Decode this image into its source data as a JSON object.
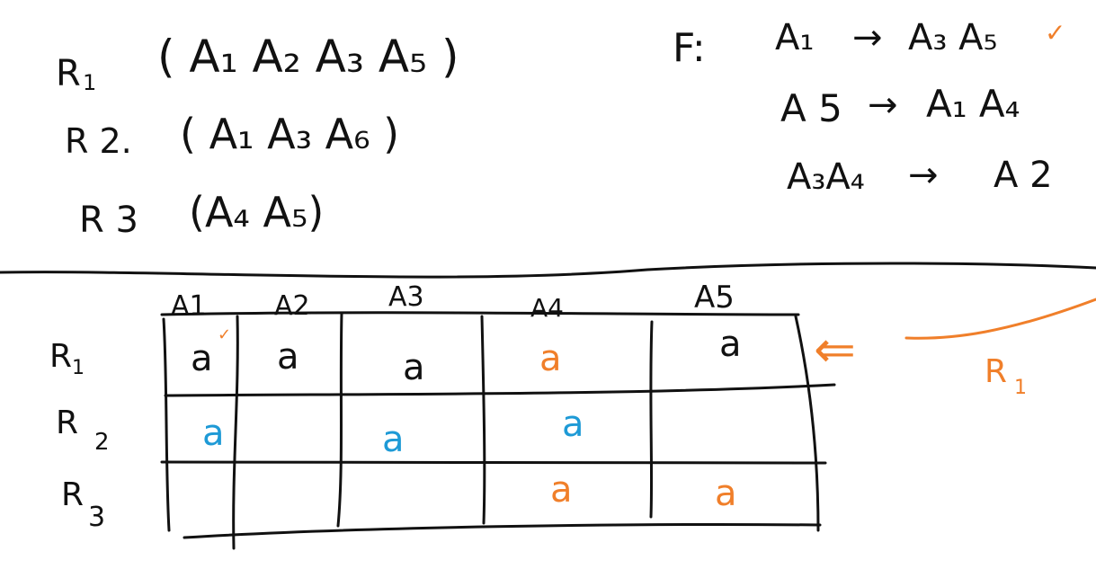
{
  "colors": {
    "ink": "#111111",
    "orange": "#f07f2a",
    "blue": "#1e9ad6",
    "background": "#ffffff"
  },
  "relations": [
    {
      "name": "R",
      "sub": "1",
      "attrs": "( A₁  A₂ A₃   A₅ )"
    },
    {
      "name": "R 2.",
      "sub": "",
      "attrs": "( A₁   A₃   A₆ )"
    },
    {
      "name": "R 3",
      "sub": "",
      "attrs": "(A₄ A₅)"
    }
  ],
  "fd_label": "F:",
  "fds": [
    {
      "lhs": "A₁",
      "arrow": "→",
      "rhs": "A₃ A₅",
      "mark": "✓"
    },
    {
      "lhs": "A 5",
      "arrow": "→",
      "rhs": "A₁ A₄",
      "mark": ""
    },
    {
      "lhs": "A₃A₄",
      "arrow": "→",
      "rhs": "A 2",
      "mark": ""
    }
  ],
  "table": {
    "columns": [
      "A1",
      "A2",
      "A3",
      "A4",
      "A5"
    ],
    "rows": [
      {
        "label": "R",
        "sub": "1",
        "cells": [
          {
            "v": "a",
            "color": "ink"
          },
          {
            "v": "a",
            "color": "ink"
          },
          {
            "v": "a",
            "color": "ink"
          },
          {
            "v": "a",
            "color": "orange"
          },
          {
            "v": "a",
            "color": "ink"
          }
        ]
      },
      {
        "label": "R",
        "sub": "2",
        "cells": [
          {
            "v": "a",
            "color": "blue"
          },
          {
            "v": "",
            "color": "ink"
          },
          {
            "v": "a",
            "color": "blue"
          },
          {
            "v": "a",
            "color": "blue"
          },
          {
            "v": "",
            "color": "ink"
          }
        ]
      },
      {
        "label": "R",
        "sub": "3",
        "cells": [
          {
            "v": "",
            "color": "ink"
          },
          {
            "v": "",
            "color": "ink"
          },
          {
            "v": "",
            "color": "ink"
          },
          {
            "v": "a",
            "color": "orange"
          },
          {
            "v": "a",
            "color": "orange"
          }
        ]
      }
    ]
  },
  "annotation": {
    "arrow": "⇐",
    "label": "R",
    "sub": "1",
    "check": "✓"
  }
}
